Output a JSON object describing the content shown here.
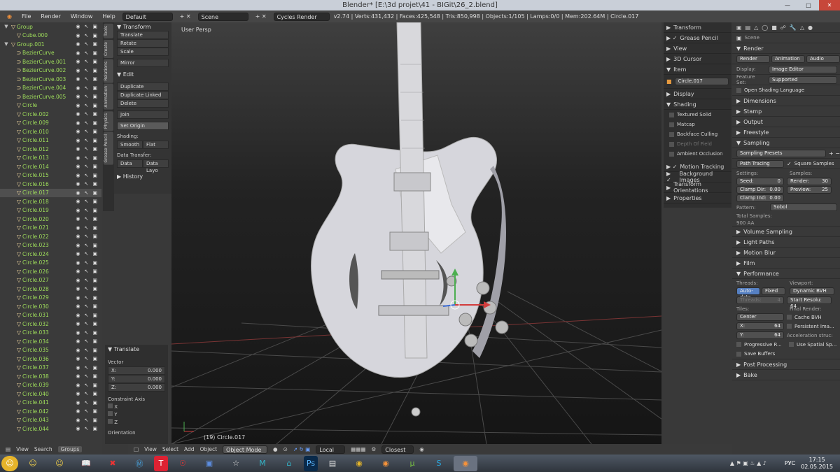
{
  "window": {
    "title": "Blender* [E:\\3d projet\\41 - BIGit\\26_2.blend]",
    "controls": [
      "—",
      "□",
      "✕"
    ]
  },
  "menu": {
    "items": [
      "File",
      "Render",
      "Window",
      "Help"
    ],
    "screen_layout": "Default",
    "scene": "Scene",
    "engine": "Cycles Render",
    "stats": "v2.74 | Verts:431,432 | Faces:425,548 | Tris:850,998 | Objects:1/105 | Lamps:0/0 | Mem:202.64M | Circle.017"
  },
  "outliner": {
    "rows": [
      {
        "label": "Group",
        "icon": "▽",
        "indent": 0,
        "tri": "▼"
      },
      {
        "label": "Cube.000",
        "icon": "▽",
        "indent": 1,
        "tri": ""
      },
      {
        "label": "Group.001",
        "icon": "▽",
        "indent": 0,
        "tri": "▼"
      },
      {
        "label": "BezierCurve",
        "icon": "⊃",
        "indent": 1,
        "tri": ""
      },
      {
        "label": "BezierCurve.001",
        "icon": "⊃",
        "indent": 1,
        "tri": ""
      },
      {
        "label": "BezierCurve.002",
        "icon": "⊃",
        "indent": 1,
        "tri": ""
      },
      {
        "label": "BezierCurve.003",
        "icon": "⊃",
        "indent": 1,
        "tri": ""
      },
      {
        "label": "BezierCurve.004",
        "icon": "⊃",
        "indent": 1,
        "tri": ""
      },
      {
        "label": "BezierCurve.005",
        "icon": "⊃",
        "indent": 1,
        "tri": ""
      },
      {
        "label": "Circle",
        "icon": "▽",
        "indent": 1,
        "tri": ""
      },
      {
        "label": "Circle.002",
        "icon": "▽",
        "indent": 1,
        "tri": ""
      },
      {
        "label": "Circle.009",
        "icon": "▽",
        "indent": 1,
        "tri": ""
      },
      {
        "label": "Circle.010",
        "icon": "▽",
        "indent": 1,
        "tri": ""
      },
      {
        "label": "Circle.011",
        "icon": "▽",
        "indent": 1,
        "tri": ""
      },
      {
        "label": "Circle.012",
        "icon": "▽",
        "indent": 1,
        "tri": ""
      },
      {
        "label": "Circle.013",
        "icon": "▽",
        "indent": 1,
        "tri": ""
      },
      {
        "label": "Circle.014",
        "icon": "▽",
        "indent": 1,
        "tri": ""
      },
      {
        "label": "Circle.015",
        "icon": "▽",
        "indent": 1,
        "tri": ""
      },
      {
        "label": "Circle.016",
        "icon": "▽",
        "indent": 1,
        "tri": ""
      },
      {
        "label": "Circle.017",
        "icon": "▽",
        "indent": 1,
        "tri": "",
        "selected": true
      },
      {
        "label": "Circle.018",
        "icon": "▽",
        "indent": 1,
        "tri": ""
      },
      {
        "label": "Circle.019",
        "icon": "▽",
        "indent": 1,
        "tri": ""
      },
      {
        "label": "Circle.020",
        "icon": "▽",
        "indent": 1,
        "tri": ""
      },
      {
        "label": "Circle.021",
        "icon": "▽",
        "indent": 1,
        "tri": ""
      },
      {
        "label": "Circle.022",
        "icon": "▽",
        "indent": 1,
        "tri": ""
      },
      {
        "label": "Circle.023",
        "icon": "▽",
        "indent": 1,
        "tri": ""
      },
      {
        "label": "Circle.024",
        "icon": "▽",
        "indent": 1,
        "tri": ""
      },
      {
        "label": "Circle.025",
        "icon": "▽",
        "indent": 1,
        "tri": ""
      },
      {
        "label": "Circle.026",
        "icon": "▽",
        "indent": 1,
        "tri": ""
      },
      {
        "label": "Circle.027",
        "icon": "▽",
        "indent": 1,
        "tri": ""
      },
      {
        "label": "Circle.028",
        "icon": "▽",
        "indent": 1,
        "tri": ""
      },
      {
        "label": "Circle.029",
        "icon": "▽",
        "indent": 1,
        "tri": ""
      },
      {
        "label": "Circle.030",
        "icon": "▽",
        "indent": 1,
        "tri": ""
      },
      {
        "label": "Circle.031",
        "icon": "▽",
        "indent": 1,
        "tri": ""
      },
      {
        "label": "Circle.032",
        "icon": "▽",
        "indent": 1,
        "tri": ""
      },
      {
        "label": "Circle.033",
        "icon": "▽",
        "indent": 1,
        "tri": ""
      },
      {
        "label": "Circle.034",
        "icon": "▽",
        "indent": 1,
        "tri": ""
      },
      {
        "label": "Circle.035",
        "icon": "▽",
        "indent": 1,
        "tri": ""
      },
      {
        "label": "Circle.036",
        "icon": "▽",
        "indent": 1,
        "tri": ""
      },
      {
        "label": "Circle.037",
        "icon": "▽",
        "indent": 1,
        "tri": ""
      },
      {
        "label": "Circle.038",
        "icon": "▽",
        "indent": 1,
        "tri": ""
      },
      {
        "label": "Circle.039",
        "icon": "▽",
        "indent": 1,
        "tri": ""
      },
      {
        "label": "Circle.040",
        "icon": "▽",
        "indent": 1,
        "tri": ""
      },
      {
        "label": "Circle.041",
        "icon": "▽",
        "indent": 1,
        "tri": ""
      },
      {
        "label": "Circle.042",
        "icon": "▽",
        "indent": 1,
        "tri": ""
      },
      {
        "label": "Circle.043",
        "icon": "▽",
        "indent": 1,
        "tri": ""
      },
      {
        "label": "Circle.044",
        "icon": "▽",
        "indent": 1,
        "tri": ""
      }
    ],
    "header": [
      "View",
      "Search",
      "Groups"
    ]
  },
  "tool_tabs": [
    "Tools",
    "Create",
    "Relations",
    "Animation",
    "Physics",
    "Grease Pencil"
  ],
  "toolshelf": {
    "transform_title": "Transform",
    "transform_buttons": [
      "Translate",
      "Rotate",
      "Scale",
      "Mirror"
    ],
    "edit_title": "Edit",
    "edit_buttons": [
      "Duplicate",
      "Duplicate Linked",
      "Delete",
      "Join"
    ],
    "set_origin": "Set Origin",
    "shading_label": "Shading:",
    "smooth": "Smooth",
    "flat": "Flat",
    "data_transfer_label": "Data Transfer:",
    "data": "Data",
    "data_layo": "Data Layo",
    "history": "History"
  },
  "operator": {
    "title": "Translate",
    "vector_label": "Vector",
    "x": "X:",
    "x_val": "0.000",
    "y": "Y:",
    "y_val": "0.000",
    "z": "Z:",
    "z_val": "0.000",
    "constraint": "Constraint Axis",
    "cx": "X",
    "cy": "Y",
    "cz": "Z",
    "orientation": "Orientation"
  },
  "viewport": {
    "label": "User Persp",
    "object": "(19) Circle.017"
  },
  "n_panel": {
    "items": [
      "Transform",
      "Grease Pencil",
      "View",
      "3D Cursor",
      "Item"
    ],
    "item_name": "Circle.017",
    "display": "Display",
    "shading": "Shading",
    "shading_checks": [
      "Textured Solid",
      "Matcap",
      "Backface Culling",
      "Depth Of Field",
      "Ambient Occlusion"
    ],
    "after": [
      "Motion Tracking",
      "Background Images",
      "Transform Orientations",
      "Properties"
    ]
  },
  "view_header": {
    "items": [
      "View",
      "Select",
      "Add",
      "Object"
    ],
    "mode": "Object Mode",
    "pivot": "Local",
    "snap": "Closest"
  },
  "properties": {
    "scene": "Scene",
    "render": "Render",
    "render_btns": [
      "Render",
      "Animation",
      "Audio"
    ],
    "display_label": "Display:",
    "display_val": "Image Editor",
    "feature_label": "Feature Set:",
    "feature_val": "Supported",
    "osl": "Open Shading Language",
    "panels_a": [
      "Dimensions",
      "Stamp",
      "Output",
      "Freestyle"
    ],
    "sampling": "Sampling",
    "sampling_presets": "Sampling Presets",
    "path_tracing": "Path Tracing",
    "square_samples": "Square Samples",
    "settings": "Settings:",
    "samples": "Samples:",
    "seed": "Seed:",
    "seed_val": "0",
    "render_s": "Render:",
    "render_val": "30",
    "clamp_dir": "Clamp Dir:",
    "clamp_dir_val": "0.00",
    "preview": "Preview:",
    "preview_val": "25",
    "clamp_ind": "Clamp Ind:",
    "clamp_ind_val": "0.00",
    "pattern": "Pattern:",
    "pattern_val": "Sobol",
    "total_samples": "Total Samples:",
    "aa": "900 AA",
    "panels_b": [
      "Volume Sampling",
      "Light Paths",
      "Motion Blur",
      "Film"
    ],
    "performance": "Performance",
    "threads": "Threads:",
    "viewport": "Viewport:",
    "auto_detect": "Auto-dete",
    "fixed": "Fixed",
    "dynamic_bvh": "Dynamic BVH",
    "threads_n": "Threads:",
    "threads_val": "4",
    "start_resol": "Start Resolu: 64",
    "tiles": "Tiles:",
    "final_render": "Final Render:",
    "center": "Center",
    "cache_bvh": "Cache BVH",
    "tx": "X:",
    "tx_val": "64",
    "persistent": "Persistent Ima...",
    "ty": "Y:",
    "ty_val": "64",
    "accel": "Acceleration struc:",
    "progressive": "Progressive R...",
    "spatial": "Use Spatial Sp...",
    "save_buffers": "Save Buffers",
    "post": "Post Processing",
    "bake": "Bake"
  },
  "taskbar": {
    "lang": "РУС",
    "time": "17:15",
    "date": "02.05.2015"
  }
}
